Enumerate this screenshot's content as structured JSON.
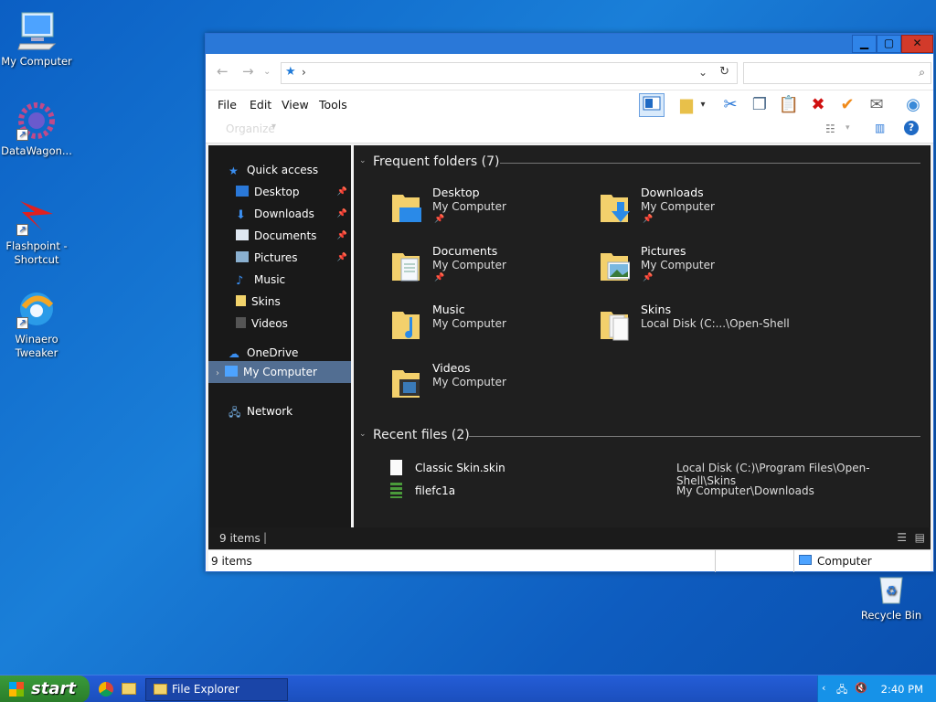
{
  "desktop": {
    "icons": [
      {
        "label": "My Computer",
        "name": "my-computer"
      },
      {
        "label": "DataWagon...",
        "name": "datawagon"
      },
      {
        "label": "Flashpoint - Shortcut",
        "name": "flashpoint"
      },
      {
        "label": "Winaero Tweaker",
        "name": "winaero-tweaker"
      },
      {
        "label": "Recycle Bin",
        "name": "recycle-bin"
      }
    ]
  },
  "window": {
    "address_glyph": "›",
    "menu": [
      "File",
      "Edit",
      "View",
      "Tools"
    ],
    "cmd_label": "Organize"
  },
  "nav": {
    "quick_access": "Quick access",
    "items": [
      {
        "label": "Desktop",
        "pinned": true
      },
      {
        "label": "Downloads",
        "pinned": true
      },
      {
        "label": "Documents",
        "pinned": true
      },
      {
        "label": "Pictures",
        "pinned": true
      },
      {
        "label": "Music",
        "pinned": false
      },
      {
        "label": "Skins",
        "pinned": false
      },
      {
        "label": "Videos",
        "pinned": false
      }
    ],
    "onedrive": "OneDrive",
    "my_computer": "My Computer",
    "network": "Network"
  },
  "content": {
    "frequent_header": "Frequent folders (7)",
    "folders": [
      {
        "name": "Desktop",
        "sub": "My Computer",
        "pinned": true
      },
      {
        "name": "Downloads",
        "sub": "My Computer",
        "pinned": true
      },
      {
        "name": "Documents",
        "sub": "My Computer",
        "pinned": true
      },
      {
        "name": "Pictures",
        "sub": "My Computer",
        "pinned": true
      },
      {
        "name": "Music",
        "sub": "My Computer",
        "pinned": false
      },
      {
        "name": "Skins",
        "sub": "Local Disk (C:...\\Open-Shell",
        "pinned": false
      },
      {
        "name": "Videos",
        "sub": "My Computer",
        "pinned": false
      }
    ],
    "recent_header": "Recent files (2)",
    "files": [
      {
        "name": "Classic Skin.skin",
        "path": "Local Disk (C:)\\Program Files\\Open-Shell\\Skins"
      },
      {
        "name": "filefc1a",
        "path": "My Computer\\Downloads"
      }
    ]
  },
  "status": {
    "inner_count": "9 items",
    "outer_count": "9 items",
    "location": "Computer"
  },
  "taskbar": {
    "start": "start",
    "task_label": "File Explorer",
    "clock": "2:40 PM"
  },
  "colors": {
    "accent": "#2a78d8",
    "dark_bg": "#1f1f1f",
    "nav_bg": "#191919",
    "selection": "#5d7ea8"
  }
}
